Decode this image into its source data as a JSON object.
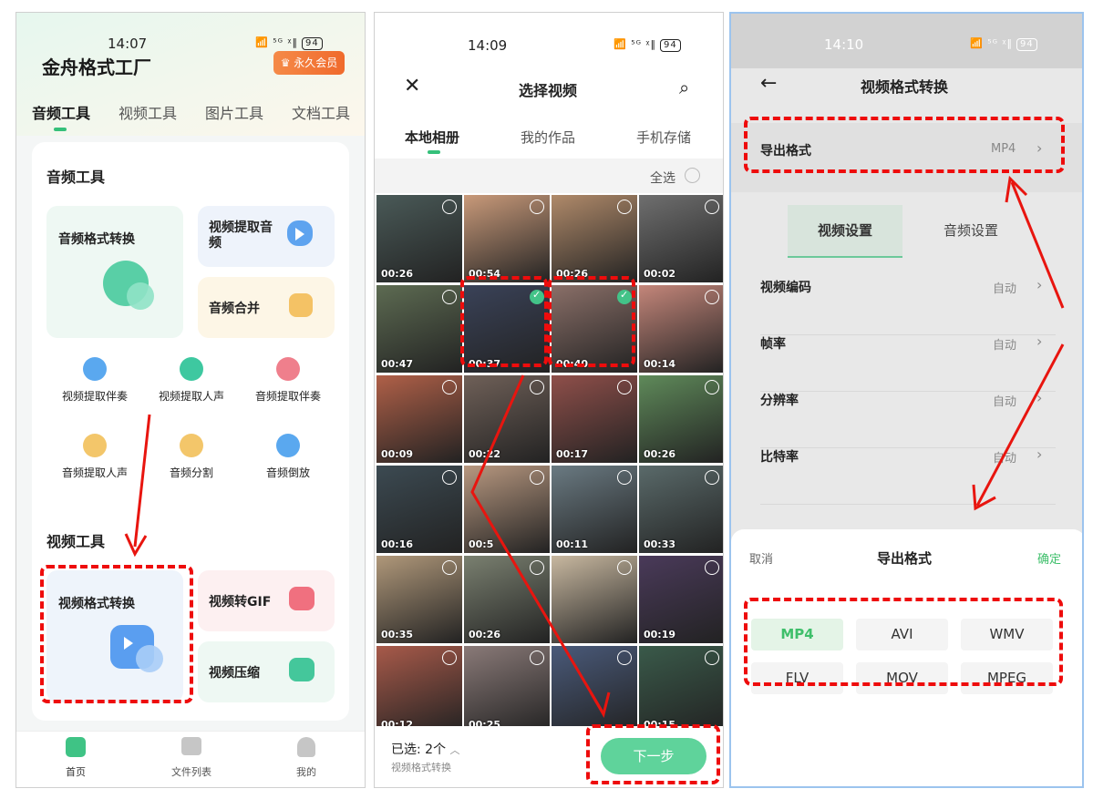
{
  "panel1": {
    "status_time": "14:07",
    "status_icons": "📶 ⁵ᴳ ᵡ‖",
    "battery": "94",
    "app_title": "金舟格式工厂",
    "vip_label": "永久会员",
    "tabs": [
      {
        "label": "音频工具"
      },
      {
        "label": "视频工具"
      },
      {
        "label": "图片工具"
      },
      {
        "label": "文档工具"
      }
    ],
    "audio_section_title": "音频工具",
    "audio_big": "音频格式转换",
    "audio_extract": "视频提取音频",
    "audio_merge": "音频合并",
    "small_tools": [
      {
        "label": "视频提取伴奏",
        "color": "#5aa8ef"
      },
      {
        "label": "视频提取人声",
        "color": "#3ec8a0"
      },
      {
        "label": "音频提取伴奏",
        "color": "#ef7f8c"
      },
      {
        "label": "音频提取人声",
        "color": "#f3c66a"
      },
      {
        "label": "音频分割",
        "color": "#f3c66a"
      },
      {
        "label": "音频倒放",
        "color": "#5aa8ef"
      }
    ],
    "video_section_title": "视频工具",
    "video_big": "视频格式转换",
    "video_gif": "视频转GIF",
    "video_compress": "视频压缩",
    "nav": [
      {
        "label": "首页"
      },
      {
        "label": "文件列表"
      },
      {
        "label": "我的"
      }
    ]
  },
  "panel2": {
    "status_time": "14:09",
    "status_icons": "📶 ⁵ᴳ ᵡ‖",
    "battery": "94",
    "title": "选择视频",
    "tabs": [
      {
        "label": "本地相册"
      },
      {
        "label": "我的作品"
      },
      {
        "label": "手机存储"
      }
    ],
    "select_all": "全选",
    "thumbs": [
      {
        "dur": "00:26",
        "color": "#4a5a58",
        "selected": false
      },
      {
        "dur": "00:54",
        "color": "#c99a7a",
        "selected": false
      },
      {
        "dur": "00:26",
        "color": "#b08a6a",
        "selected": false
      },
      {
        "dur": "00:02",
        "color": "#6f6f6f",
        "selected": false
      },
      {
        "dur": "00:47",
        "color": "#5d6b52",
        "selected": false
      },
      {
        "dur": "00:37",
        "color": "#3a4258",
        "selected": true
      },
      {
        "dur": "00:40",
        "color": "#8a6f68",
        "selected": true
      },
      {
        "dur": "00:14",
        "color": "#c4867a",
        "selected": false
      },
      {
        "dur": "00:09",
        "color": "#b06048",
        "selected": false
      },
      {
        "dur": "00:22",
        "color": "#6f6058",
        "selected": false
      },
      {
        "dur": "00:17",
        "color": "#8f4f4a",
        "selected": false
      },
      {
        "dur": "00:26",
        "color": "#5f8a5a",
        "selected": false
      },
      {
        "dur": "00:16",
        "color": "#3c4a52",
        "selected": false
      },
      {
        "dur": "00:5",
        "color": "#b89880",
        "selected": false
      },
      {
        "dur": "00:11",
        "color": "#6a7a82",
        "selected": false
      },
      {
        "dur": "00:33",
        "color": "#5a6a6a",
        "selected": false
      },
      {
        "dur": "00:35",
        "color": "#b0987a",
        "selected": false
      },
      {
        "dur": "00:26",
        "color": "#7a8070",
        "selected": false
      },
      {
        "dur": "",
        "color": "#c8b8a0",
        "selected": false
      },
      {
        "dur": "00:19",
        "color": "#4a3a5a",
        "selected": false
      },
      {
        "dur": "00:12",
        "color": "#a85a4a",
        "selected": false
      },
      {
        "dur": "00:25",
        "color": "#8a7a78",
        "selected": false
      },
      {
        "dur": "",
        "color": "#4a5a7a",
        "selected": false
      },
      {
        "dur": "00:15",
        "color": "#3a5a4a",
        "selected": false
      }
    ],
    "selected_label": "已选: 2个",
    "selected_sub": "视频格式转换",
    "next_button": "下一步"
  },
  "panel3": {
    "status_time": "14:10",
    "status_icons": "📶 ⁵ᴳ ᵡ‖",
    "battery": "94",
    "title": "视频格式转换",
    "export_label": "导出格式",
    "export_value": "MP4",
    "tabs": [
      {
        "label": "视频设置"
      },
      {
        "label": "音频设置"
      }
    ],
    "rows": [
      {
        "label": "视频编码",
        "value": "自动"
      },
      {
        "label": "帧率",
        "value": "自动"
      },
      {
        "label": "分辨率",
        "value": "自动"
      },
      {
        "label": "比特率",
        "value": "自动"
      }
    ],
    "sheet_cancel": "取消",
    "sheet_title": "导出格式",
    "sheet_confirm": "确定",
    "formats": [
      {
        "label": "MP4",
        "active": true
      },
      {
        "label": "AVI",
        "active": false
      },
      {
        "label": "WMV",
        "active": false
      },
      {
        "label": "FLV",
        "active": false
      },
      {
        "label": "MOV",
        "active": false
      },
      {
        "label": "MPEG",
        "active": false
      }
    ]
  }
}
